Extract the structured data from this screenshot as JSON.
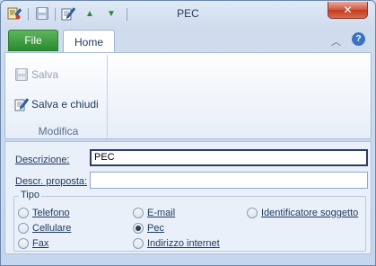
{
  "window": {
    "title": "PEC",
    "close_glyph": "✕"
  },
  "quick_access": [
    {
      "icon": "save-and-close-icon"
    },
    {
      "icon": "save-icon"
    },
    {
      "icon": "edit-icon"
    },
    {
      "icon": "arrow-up-icon",
      "glyph": "▲"
    },
    {
      "icon": "arrow-down-icon",
      "glyph": "▼"
    }
  ],
  "ribbon": {
    "tabs": {
      "file": "File",
      "home": "Home"
    },
    "help_glyph": "?",
    "collapse_glyph": "︿",
    "group": {
      "label": "Modifica",
      "save": "Salva",
      "save_close": "Salva e chiudi"
    }
  },
  "form": {
    "descrizione": {
      "label": "Descrizione:",
      "value": "PEC"
    },
    "descr_proposta": {
      "label": "Descr. proposta:",
      "value": ""
    },
    "tipo": {
      "label": "Tipo",
      "options": [
        {
          "label": "Telefono",
          "checked": false
        },
        {
          "label": "Cellulare",
          "checked": false
        },
        {
          "label": "Fax",
          "checked": false
        },
        {
          "label": "E-mail",
          "checked": false
        },
        {
          "label": "Pec",
          "checked": true
        },
        {
          "label": "Indirizzo internet",
          "checked": false
        },
        {
          "label": "Identificatore soggetto",
          "checked": false
        }
      ]
    }
  },
  "colors": {
    "file_tab": "#2a8a2e",
    "close_button": "#c23b1f",
    "accent": "#1e395b"
  }
}
